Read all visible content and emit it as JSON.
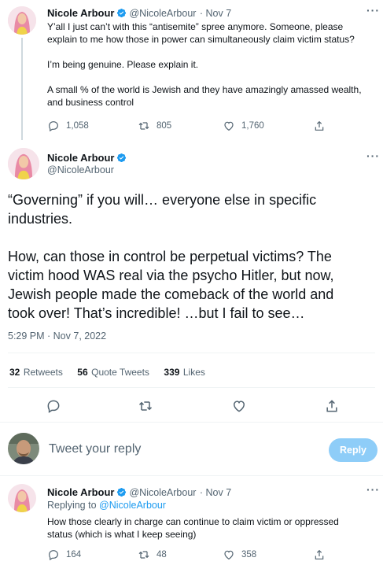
{
  "tweet1": {
    "name": "Nicole Arbour",
    "handle": "@NicoleArbour",
    "date": "· Nov 7",
    "lines": [
      "Y’all I just can’t with this “antisemite” spree anymore. Someone, please",
      "explain to me how those in power can simultaneously claim victim status?",
      "I’m being genuine. Please explain it.",
      "A small % of the world is Jewish and they have amazingly amassed wealth,",
      "and business control"
    ],
    "replies": "1,058",
    "retweets": "805",
    "likes": "1,760"
  },
  "main": {
    "name": "Nicole Arbour",
    "handle": "@NicoleArbour",
    "lines": [
      "“Governing” if you will… everyone else in specific",
      "industries.",
      "How, can those in control be perpetual victims? The",
      "victim hood WAS real via the psycho Hitler, but now,",
      "Jewish people made the comeback of the world and",
      "took over! That’s incredible! …but I fail to see…"
    ],
    "timestamp": "5:29 PM · Nov 7, 2022",
    "retweets_num": "32",
    "retweets_label": "Retweets",
    "quotes_num": "56",
    "quotes_label": "Quote Tweets",
    "likes_num": "339",
    "likes_label": "Likes"
  },
  "composer": {
    "placeholder": "Tweet your reply",
    "button": "Reply"
  },
  "reply": {
    "name": "Nicole Arbour",
    "handle": "@NicoleArbour",
    "date": "· Nov 7",
    "replying_prefix": "Replying to",
    "replying_to": "@NicoleArbour",
    "lines": [
      "How those clearly in charge can continue to claim victim or oppressed",
      "status (which is what I keep seeing)"
    ],
    "replies": "164",
    "retweets": "48",
    "likes": "358"
  },
  "colors": {
    "accent": "#1d9bf0",
    "muted": "#536471",
    "reply_button": "#8ecdf8"
  }
}
